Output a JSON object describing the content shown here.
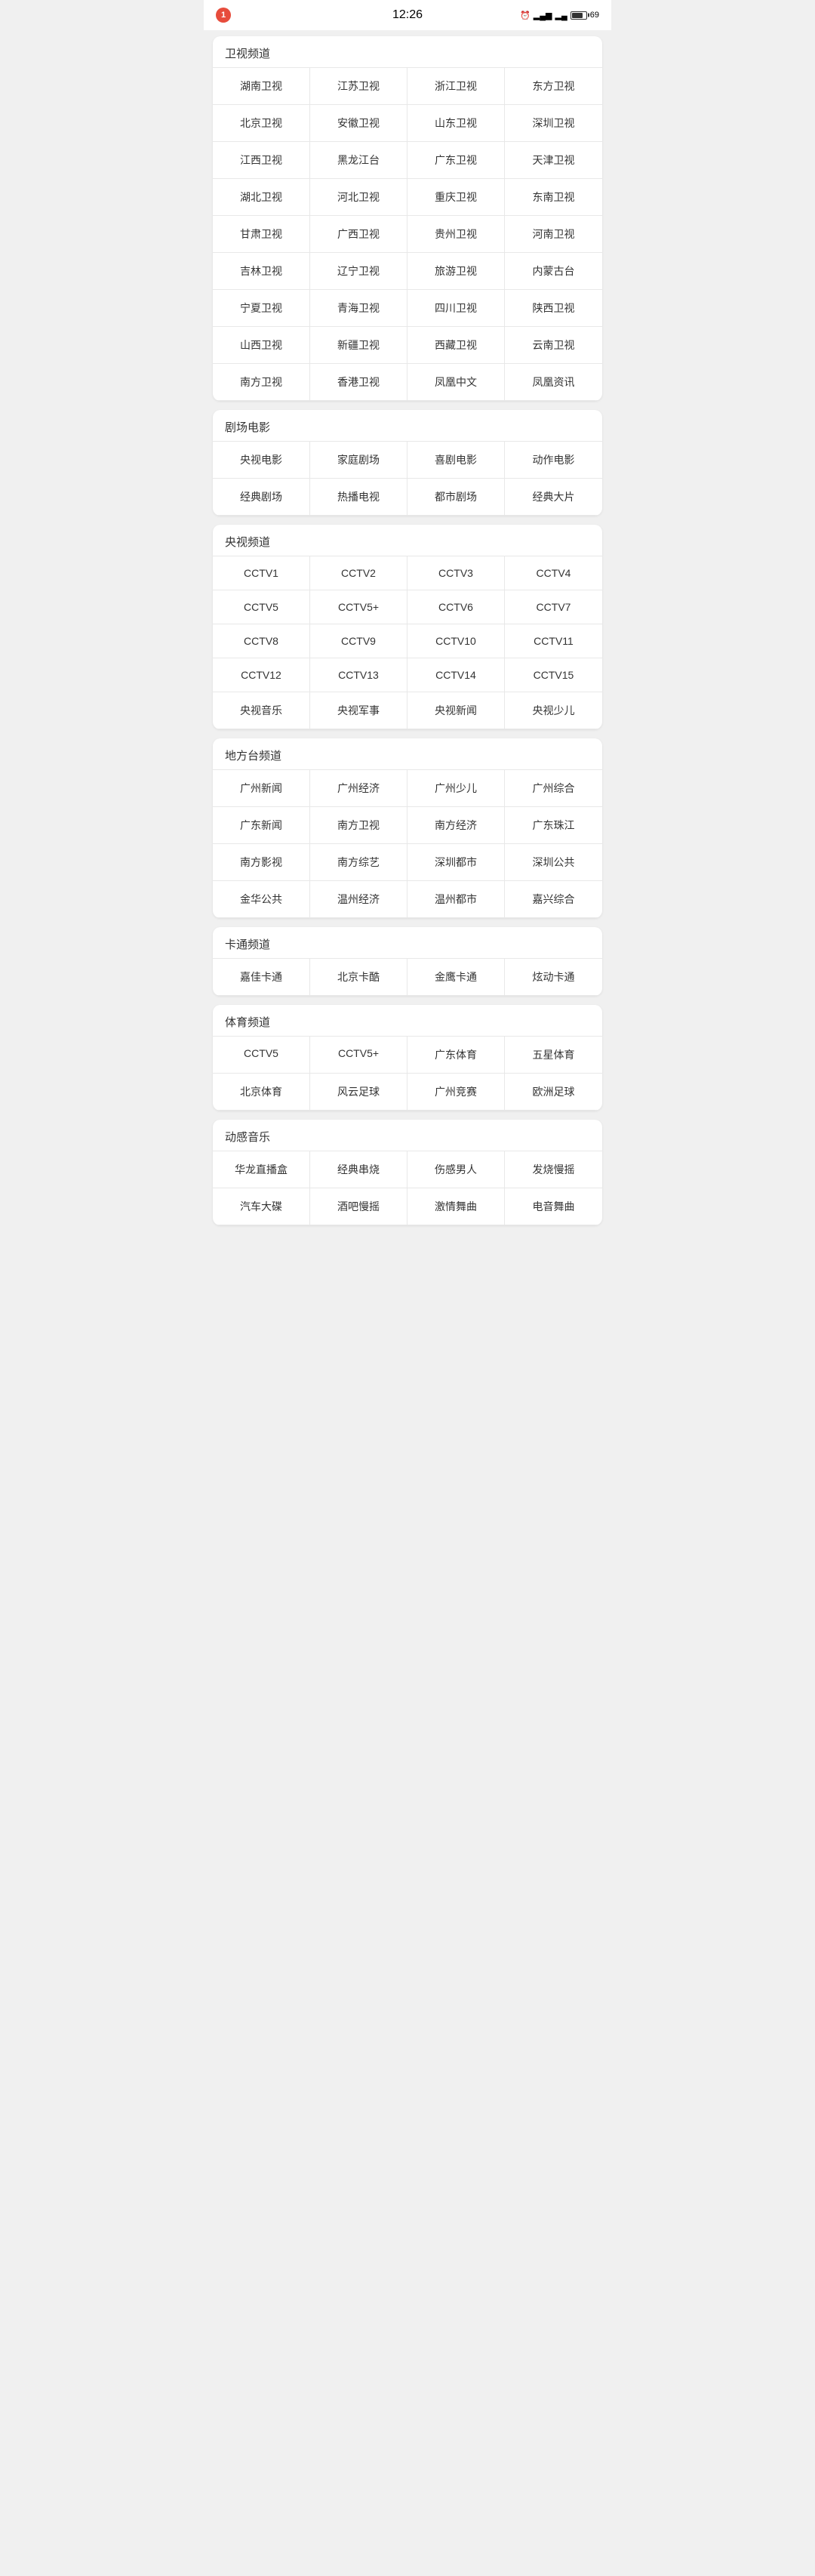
{
  "statusBar": {
    "notification": "1",
    "time": "12:26",
    "battery": "69"
  },
  "sections": [
    {
      "id": "satellite",
      "title": "卫视频道",
      "channels": [
        "湖南卫视",
        "江苏卫视",
        "浙江卫视",
        "东方卫视",
        "北京卫视",
        "安徽卫视",
        "山东卫视",
        "深圳卫视",
        "江西卫视",
        "黑龙江台",
        "广东卫视",
        "天津卫视",
        "湖北卫视",
        "河北卫视",
        "重庆卫视",
        "东南卫视",
        "甘肃卫视",
        "广西卫视",
        "贵州卫视",
        "河南卫视",
        "吉林卫视",
        "辽宁卫视",
        "旅游卫视",
        "内蒙古台",
        "宁夏卫视",
        "青海卫视",
        "四川卫视",
        "陕西卫视",
        "山西卫视",
        "新疆卫视",
        "西藏卫视",
        "云南卫视",
        "南方卫视",
        "香港卫视",
        "凤凰中文",
        "凤凰资讯"
      ]
    },
    {
      "id": "theater",
      "title": "剧场电影",
      "channels": [
        "央视电影",
        "家庭剧场",
        "喜剧电影",
        "动作电影",
        "经典剧场",
        "热播电视",
        "都市剧场",
        "经典大片"
      ]
    },
    {
      "id": "cctv",
      "title": "央视频道",
      "channels": [
        "CCTV1",
        "CCTV2",
        "CCTV3",
        "CCTV4",
        "CCTV5",
        "CCTV5+",
        "CCTV6",
        "CCTV7",
        "CCTV8",
        "CCTV9",
        "CCTV10",
        "CCTV11",
        "CCTV12",
        "CCTV13",
        "CCTV14",
        "CCTV15",
        "央视音乐",
        "央视军事",
        "央视新闻",
        "央视少儿"
      ]
    },
    {
      "id": "local",
      "title": "地方台频道",
      "channels": [
        "广州新闻",
        "广州经济",
        "广州少儿",
        "广州综合",
        "广东新闻",
        "南方卫视",
        "南方经济",
        "广东珠江",
        "南方影视",
        "南方综艺",
        "深圳都市",
        "深圳公共",
        "金华公共",
        "温州经济",
        "温州都市",
        "嘉兴综合"
      ]
    },
    {
      "id": "cartoon",
      "title": "卡通频道",
      "channels": [
        "嘉佳卡通",
        "北京卡酷",
        "金鹰卡通",
        "炫动卡通"
      ]
    },
    {
      "id": "sports",
      "title": "体育频道",
      "channels": [
        "CCTV5",
        "CCTV5+",
        "广东体育",
        "五星体育",
        "北京体育",
        "风云足球",
        "广州竞赛",
        "欧洲足球"
      ]
    },
    {
      "id": "music",
      "title": "动感音乐",
      "channels": [
        "华龙直播盒",
        "经典串烧",
        "伤感男人",
        "发烧慢摇",
        "汽车大碟",
        "酒吧慢摇",
        "激情舞曲",
        "电音舞曲"
      ]
    }
  ]
}
